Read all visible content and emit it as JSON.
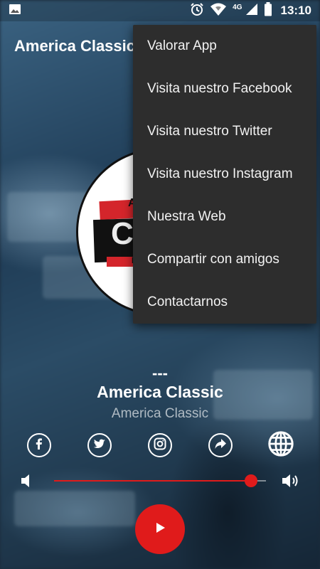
{
  "status_bar": {
    "time": "13:10",
    "network_label": "4G",
    "icons": [
      "image-notification-icon",
      "alarm-icon",
      "wifi-icon",
      "cell-signal-icon",
      "battery-icon"
    ]
  },
  "app": {
    "title": "America Classic"
  },
  "overflow_menu": {
    "items": [
      "Valorar App",
      "Visita nuestro Facebook",
      "Visita nuestro Twitter",
      "Visita nuestro Instagram",
      "Nuestra Web",
      "Compartir con amigos",
      "Contactarnos"
    ]
  },
  "player": {
    "now_playing": "---",
    "station_name": "America Classic",
    "station_subtitle": "America Classic",
    "volume_level": 0.93,
    "is_playing": false
  },
  "social_buttons": [
    "facebook-icon",
    "twitter-icon",
    "instagram-icon",
    "share-icon",
    "globe-icon"
  ],
  "colors": {
    "accent": "#e01b1b",
    "menu_background": "#2d2d2d",
    "text": "#ffffff"
  }
}
